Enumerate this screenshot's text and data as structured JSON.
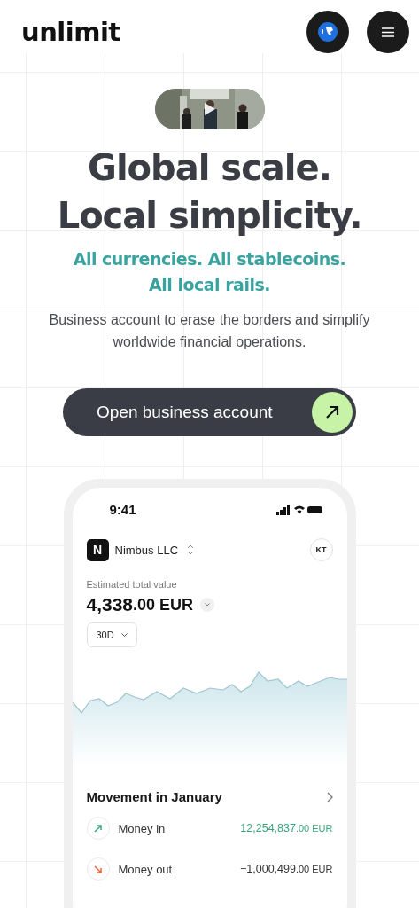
{
  "header": {
    "logo": "unlimit"
  },
  "hero": {
    "title_lines": [
      "Global scale.",
      "Local simplicity."
    ],
    "subtitle_lines": [
      "All currencies. All stablecoins.",
      "All local rails."
    ],
    "description": "Business account to erase the borders and simplify worldwide financial operations.",
    "cta": "Open business account"
  },
  "phone": {
    "time": "9:41",
    "company_initial": "N",
    "company": "Nimbus LLC",
    "user_initials": "KT",
    "balance_label": "Estimated total value",
    "balance_whole": "4,338",
    "balance_fraction": ".00 EUR",
    "period": "30D",
    "movement_title": "Movement in January",
    "movements": [
      {
        "kind": "in",
        "label": "Money in",
        "whole": "12,254,837",
        "fraction": ".00 EUR"
      },
      {
        "kind": "out",
        "label": "Money out",
        "whole": "−1,000,499",
        "fraction": ".00 EUR"
      }
    ]
  }
}
